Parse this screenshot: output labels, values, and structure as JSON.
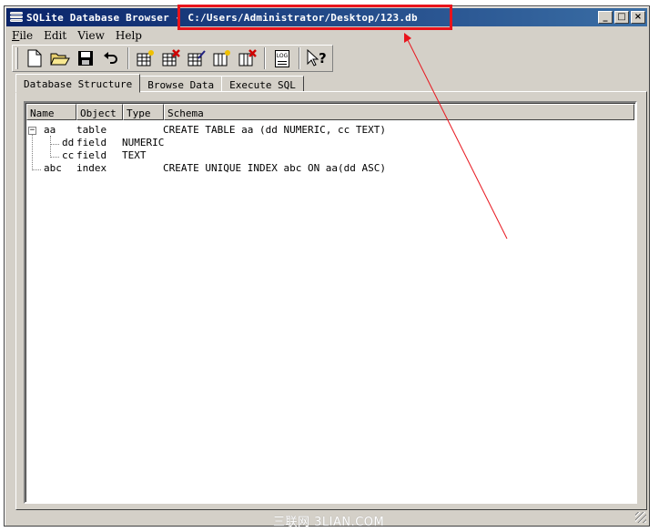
{
  "window": {
    "title": "SQLite Database Browser - C:/Users/Administrator/Desktop/123.db",
    "minimize_label": "_",
    "maximize_label": "□",
    "close_label": "×"
  },
  "menu": [
    {
      "label": "File",
      "mnemonic": "F"
    },
    {
      "label": "Edit",
      "mnemonic": "E"
    },
    {
      "label": "View",
      "mnemonic": "V"
    },
    {
      "label": "Help",
      "mnemonic": "H"
    }
  ],
  "toolbar": {
    "buttons": [
      "new-database",
      "open-database",
      "save-database",
      "undo",
      "create-table",
      "delete-table",
      "modify-table",
      "create-index",
      "delete-index",
      "sql-log",
      "whats-this"
    ],
    "log_label": "LOG"
  },
  "tabs": [
    {
      "label": "Database Structure",
      "active": true
    },
    {
      "label": "Browse Data",
      "active": false
    },
    {
      "label": "Execute SQL",
      "active": false
    }
  ],
  "structure": {
    "columns": [
      "Name",
      "Object",
      "Type",
      "Schema"
    ],
    "rows": [
      {
        "name": "aa",
        "object": "table",
        "type": "",
        "schema": "CREATE TABLE aa (dd NUMERIC, cc TEXT)"
      },
      {
        "name": "dd",
        "object": "field",
        "type": "NUMERIC",
        "schema": ""
      },
      {
        "name": "cc",
        "object": "field",
        "type": "TEXT",
        "schema": ""
      },
      {
        "name": "abc",
        "object": "index",
        "type": "",
        "schema": "CREATE UNIQUE INDEX abc ON aa(dd ASC)"
      }
    ]
  },
  "annotation": {
    "color": "#e8141c"
  },
  "watermark": "三联网 3LIAN.COM"
}
